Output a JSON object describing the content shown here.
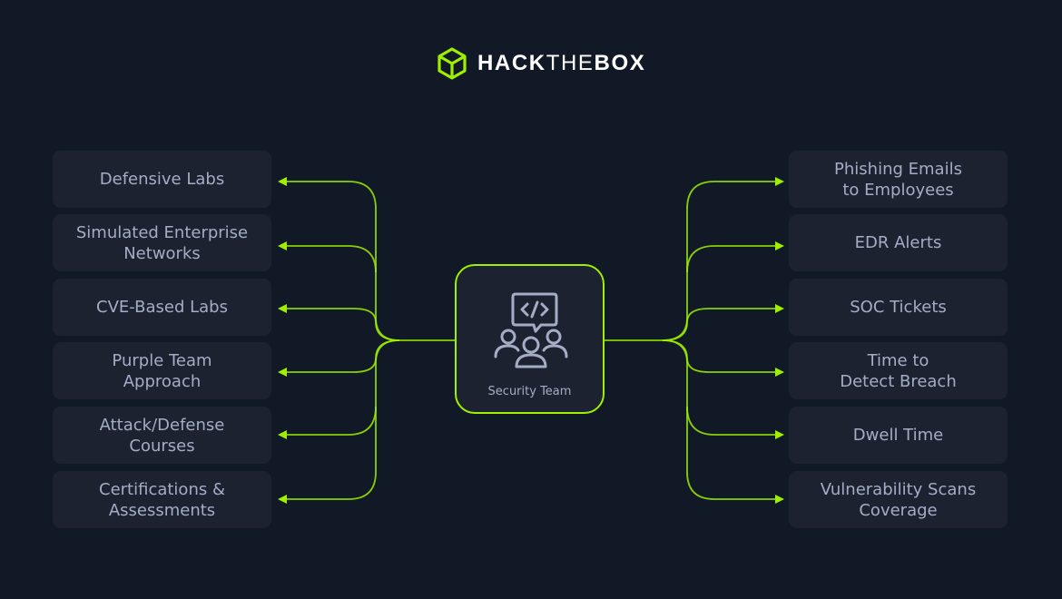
{
  "brand": {
    "name_bold_1": "HACK",
    "name_thin": "THE",
    "name_bold_2": "BOX",
    "accent_color": "#9fef00"
  },
  "center": {
    "label": "Security Team",
    "icon": "team-code-chat-icon"
  },
  "left_items": [
    {
      "label": "Defensive Labs"
    },
    {
      "label": "Simulated Enterprise\nNetworks"
    },
    {
      "label": "CVE-Based Labs"
    },
    {
      "label": "Purple Team\nApproach"
    },
    {
      "label": "Attack/Defense\nCourses"
    },
    {
      "label": "Certifications &\nAssessments"
    }
  ],
  "right_items": [
    {
      "label": "Phishing Emails\nto Employees"
    },
    {
      "label": "EDR Alerts"
    },
    {
      "label": "SOC Tickets"
    },
    {
      "label": "Time to\nDetect Breach"
    },
    {
      "label": "Dwell Time"
    },
    {
      "label": "Vulnerability Scans\nCoverage"
    }
  ]
}
